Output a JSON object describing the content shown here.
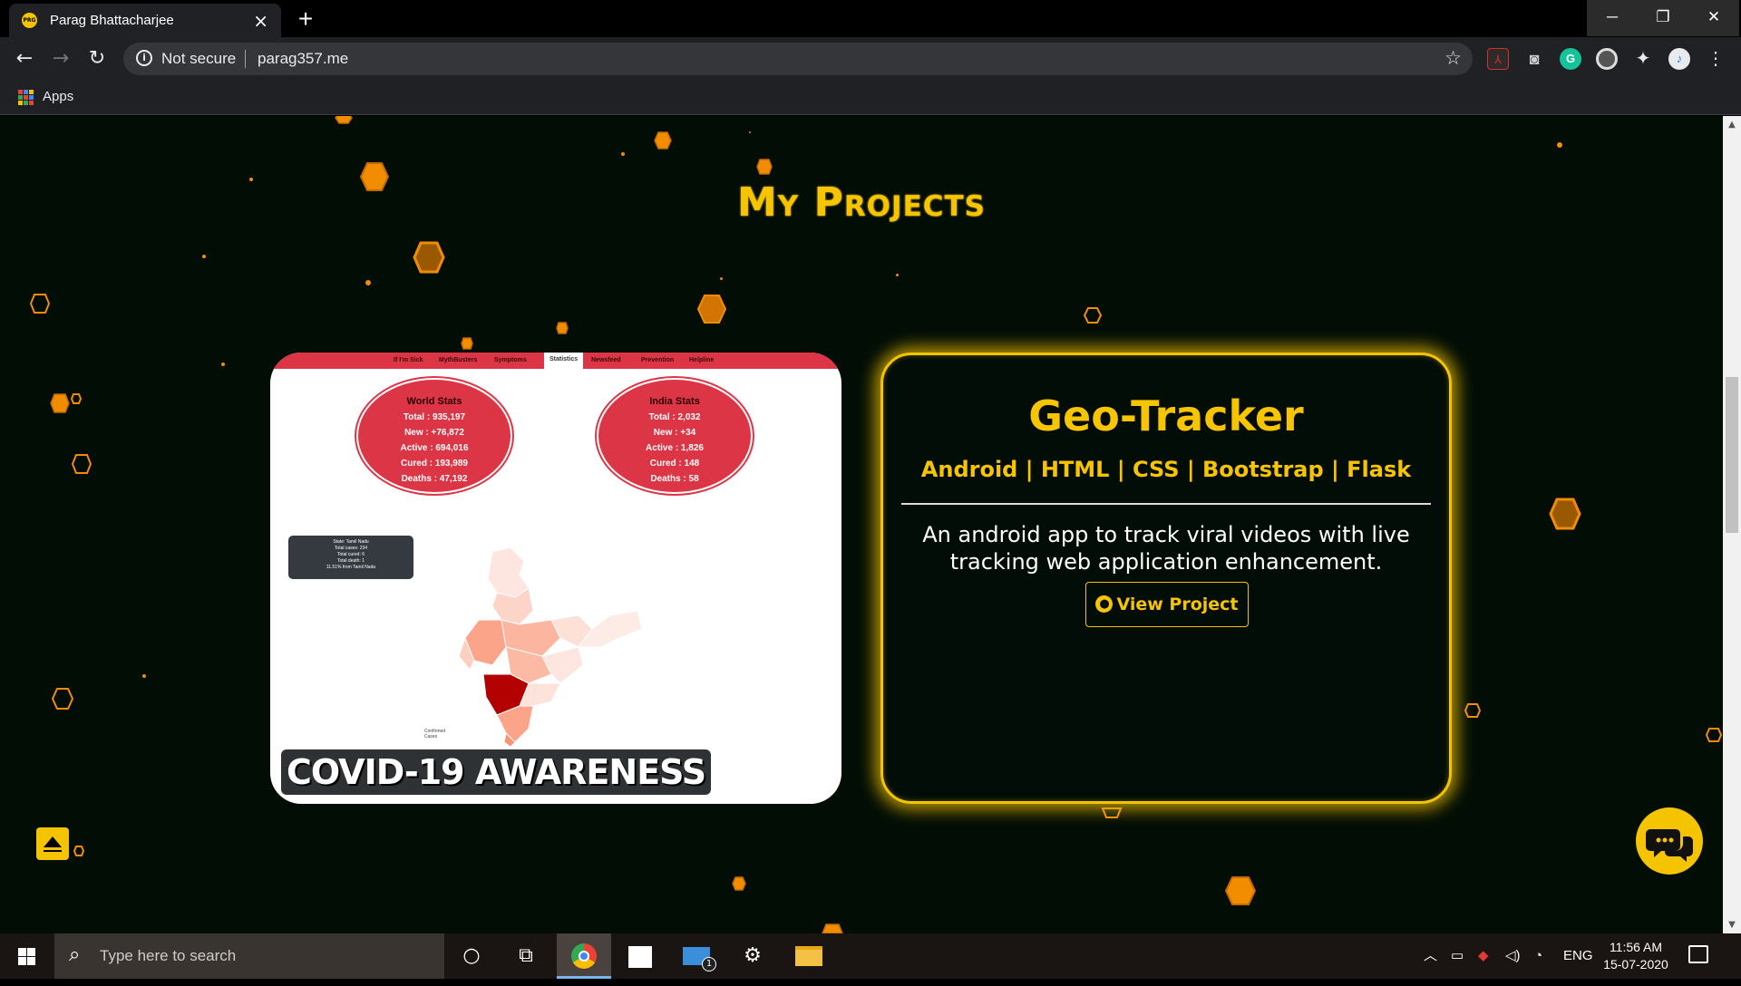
{
  "browser": {
    "tab_title": "Parag Bhattacharjee",
    "tab_favicon_text": "PRG",
    "new_tab": "+",
    "security": "Not secure",
    "url": "parag357.me",
    "bookmarks_apps": "Apps"
  },
  "page": {
    "section_title": "My Projects",
    "project": {
      "image_caption": "COVID-19 AWARENESS",
      "title": "Geo-Tracker",
      "tech": "Android | HTML | CSS | Bootstrap | Flask",
      "description": "An android app to track viral videos with live tracking web application enhancement.",
      "button_label": "View Project"
    },
    "screenshot": {
      "nav": [
        "If I'm Sick",
        "MythBusters",
        "Symptoms",
        "Statistics",
        "Newsfeed",
        "Prevention",
        "Helpline"
      ],
      "active_nav": "Statistics",
      "world": {
        "heading": "World Stats",
        "lines": [
          "Total : 935,197",
          "New : +76,872",
          "Active : 694,016",
          "Cured : 193,989",
          "Deaths : 47,192"
        ]
      },
      "india": {
        "heading": "India Stats",
        "lines": [
          "Total : 2,032",
          "New : +34",
          "Active : 1,826",
          "Cured : 148",
          "Deaths : 58"
        ]
      },
      "tooltip": [
        "State: Tamil Nadu",
        "Total cases: 234",
        "Total cured: 6",
        "Total death: 1",
        "11.51% from Tamil Nadu"
      ],
      "legend": [
        "Confirmed",
        "Cases"
      ]
    }
  },
  "taskbar": {
    "search_placeholder": "Type here to search",
    "mail_badge": "1",
    "language": "ENG",
    "time": "11:56 AM",
    "date": "15-07-2020"
  },
  "colors": {
    "accent": "#f5c400",
    "page_bg": "#020d05",
    "hex": "#f28c00",
    "covid_red": "#dc3545"
  },
  "icons": {
    "back": "arrow-left-icon",
    "forward": "arrow-right-icon",
    "reload": "reload-icon",
    "bookmark": "star-icon",
    "github": "github-icon",
    "chat": "chat-bubbles-icon"
  }
}
